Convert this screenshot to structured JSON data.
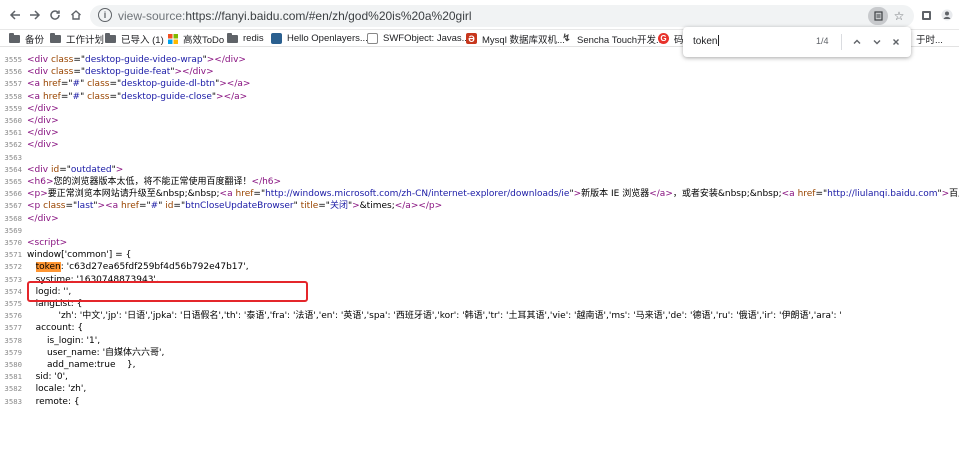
{
  "browser": {
    "url_prefix": "view-source:",
    "url_main": "https://fanyi.baidu.com/#en/zh/god%20is%20a%20girl"
  },
  "bookmarks": [
    {
      "label": "备份",
      "icon": "folder-icon"
    },
    {
      "label": "工作计划",
      "icon": "folder-icon"
    },
    {
      "label": "已导入 (1)",
      "icon": "folder-icon"
    },
    {
      "label": "高效ToDo",
      "icon": "windows-icon"
    },
    {
      "label": "redis",
      "icon": "folder-icon"
    },
    {
      "label": "Hello Openlayers...",
      "icon": "site-icon"
    },
    {
      "label": "SWFObject: Javas...",
      "icon": "doc-icon"
    },
    {
      "label": "Mysql 数据库双机...",
      "icon": "mysql-icon"
    },
    {
      "label": "Sencha Touch开发...",
      "icon": "leaf-icon"
    },
    {
      "label": "码",
      "icon": "google-icon"
    },
    {
      "label": "于时...",
      "icon": "site-icon"
    }
  ],
  "find": {
    "query": "token",
    "count": "1/4"
  },
  "source_lines": [
    {
      "n": "3555",
      "html": "<span class=\"tag\">&lt;div</span> <span class=\"attr\">class</span>=\"<span class=\"val\">desktop-guide-video-wrap</span>\"<span class=\"tag\">&gt;&lt;/div&gt;</span>"
    },
    {
      "n": "3556",
      "html": "<span class=\"tag\">&lt;div</span> <span class=\"attr\">class</span>=\"<span class=\"val\">desktop-guide-feat</span>\"<span class=\"tag\">&gt;&lt;/div&gt;</span>"
    },
    {
      "n": "3557",
      "html": "<span class=\"tag\">&lt;a</span> <span class=\"attr\">href</span>=\"<span class=\"val\">#</span>\" <span class=\"attr\">class</span>=\"<span class=\"val\">desktop-guide-dl-btn</span>\"<span class=\"tag\">&gt;&lt;/a&gt;</span>"
    },
    {
      "n": "3558",
      "html": "<span class=\"tag\">&lt;a</span> <span class=\"attr\">href</span>=\"<span class=\"val\">#</span>\" <span class=\"attr\">class</span>=\"<span class=\"val\">desktop-guide-close</span>\"<span class=\"tag\">&gt;&lt;/a&gt;</span>"
    },
    {
      "n": "3559",
      "html": "<span class=\"tag\">&lt;/div&gt;</span>"
    },
    {
      "n": "3560",
      "html": "<span class=\"tag\">&lt;/div&gt;</span>"
    },
    {
      "n": "3561",
      "html": "<span class=\"tag\">&lt;/div&gt;</span>"
    },
    {
      "n": "3562",
      "html": "<span class=\"tag\">&lt;/div&gt;</span>"
    },
    {
      "n": "3563",
      "html": ""
    },
    {
      "n": "3564",
      "html": "<span class=\"tag\">&lt;div</span> <span class=\"attr\">id</span>=\"<span class=\"val\">outdated</span>\"<span class=\"tag\">&gt;</span>"
    },
    {
      "n": "3565",
      "html": "<span class=\"tag\">&lt;h6&gt;</span>您的浏览器版本太低，将不能正常使用百度翻译！<span class=\"tag\">&lt;/h6&gt;</span>"
    },
    {
      "n": "3566",
      "html": "<span class=\"tag\">&lt;p&gt;</span>要正常浏览本网站请升级至&amp;nbsp;&amp;nbsp;<span class=\"tag\">&lt;a</span> <span class=\"attr\">href</span>=\"<span class=\"val\">http://windows.microsoft.com/zh-CN/internet-explorer/downloads/ie</span>\"<span class=\"tag\">&gt;</span>新版本 IE 浏览器<span class=\"tag\">&lt;/a&gt;</span>，或者安装&amp;nbsp;&amp;nbsp;<span class=\"tag\">&lt;a</span> <span class=\"attr\">href</span>=\"<span class=\"val\">http://liulanqi.baidu.com</span>\"<span class=\"tag\">&gt;</span>百度"
    },
    {
      "n": "3567",
      "html": "<span class=\"tag\">&lt;p</span> <span class=\"attr\">class</span>=\"<span class=\"val\">last</span>\"<span class=\"tag\">&gt;&lt;a</span> <span class=\"attr\">href</span>=\"<span class=\"val\">#</span>\" <span class=\"attr\">id</span>=\"<span class=\"val\">btnCloseUpdateBrowser</span>\" <span class=\"attr\">title</span>=\"<span class=\"val\">关闭</span>\"<span class=\"tag\">&gt;</span>&amp;times;<span class=\"tag\">&lt;/a&gt;&lt;/p&gt;</span>"
    },
    {
      "n": "3568",
      "html": "<span class=\"tag\">&lt;/div&gt;</span>"
    },
    {
      "n": "3569",
      "html": ""
    },
    {
      "n": "3570",
      "html": "<span class=\"tag\">&lt;script&gt;</span>"
    },
    {
      "n": "3571",
      "html": "window['common'] = {"
    },
    {
      "n": "3572",
      "html": "&nbsp;&nbsp;&nbsp;<span class=\"hl\">token</span>: 'c63d27ea65fdf259bf4d56b792e47b17',"
    },
    {
      "n": "3573",
      "html": "&nbsp;&nbsp;&nbsp;systime: '1630748873943',"
    },
    {
      "n": "3574",
      "html": "&nbsp;&nbsp;&nbsp;logid: '',"
    },
    {
      "n": "3575",
      "html": "&nbsp;&nbsp;&nbsp;langList: {"
    },
    {
      "n": "3576",
      "html": "&nbsp;&nbsp;&nbsp;&nbsp;&nbsp;&nbsp;&nbsp;&nbsp;&nbsp;&nbsp;&nbsp;'zh': '中文','jp': '日语','jpka': '日语假名','th': '泰语','fra': '法语','en': '英语','spa': '西班牙语','kor': '韩语','tr': '土耳其语','vie': '越南语','ms': '马来语','de': '德语','ru': '俄语','ir': '伊朗语','ara': '"
    },
    {
      "n": "3577",
      "html": "&nbsp;&nbsp;&nbsp;account: {"
    },
    {
      "n": "3578",
      "html": "&nbsp;&nbsp;&nbsp;&nbsp;&nbsp;&nbsp;&nbsp;is_login: '1',"
    },
    {
      "n": "3579",
      "html": "&nbsp;&nbsp;&nbsp;&nbsp;&nbsp;&nbsp;&nbsp;user_name: '自媒体六六哥',"
    },
    {
      "n": "3580",
      "html": "&nbsp;&nbsp;&nbsp;&nbsp;&nbsp;&nbsp;&nbsp;add_name:true &nbsp;&nbsp;&nbsp;},"
    },
    {
      "n": "3581",
      "html": "&nbsp;&nbsp;&nbsp;sid: '0',"
    },
    {
      "n": "3582",
      "html": "&nbsp;&nbsp;&nbsp;locale: 'zh',"
    },
    {
      "n": "3583",
      "html": "&nbsp;&nbsp;&nbsp;remote: {"
    }
  ]
}
